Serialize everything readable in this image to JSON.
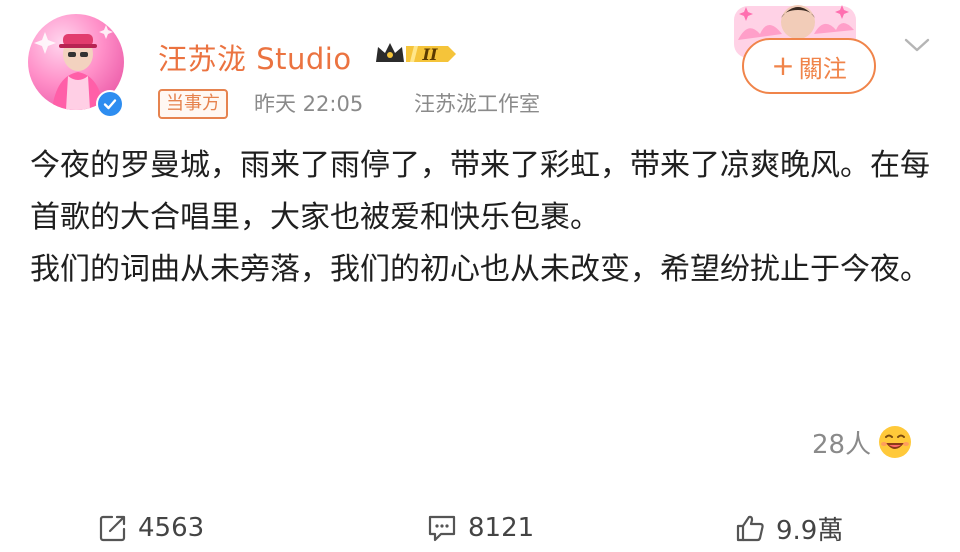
{
  "post": {
    "author": {
      "name": "汪苏泷 Studio",
      "vip_level": "II",
      "verified": true
    },
    "tag": "当事方",
    "time": "昨天 22:05",
    "source": "汪苏泷工作室",
    "follow_label": "關注",
    "content": {
      "paragraph1": "今夜的罗曼城，雨来了雨停了，带来了彩虹，带来了凉爽晚风。在每首歌的大合唱里，大家也被爱和快乐包裹。",
      "paragraph2": "我们的词曲从未旁落，我们的初心也从未改变，希望纷扰止于今夜。"
    },
    "reactions": {
      "count": "28人",
      "emoji": "laughing-face-icon"
    },
    "actions": {
      "repost_count": "4563",
      "comment_count": "8121",
      "like_count": "9.9萬"
    }
  },
  "colors": {
    "accent_orange": "#eb7340",
    "verified_blue": "#2e8df0",
    "secondary_text": "#8a8a8a"
  }
}
